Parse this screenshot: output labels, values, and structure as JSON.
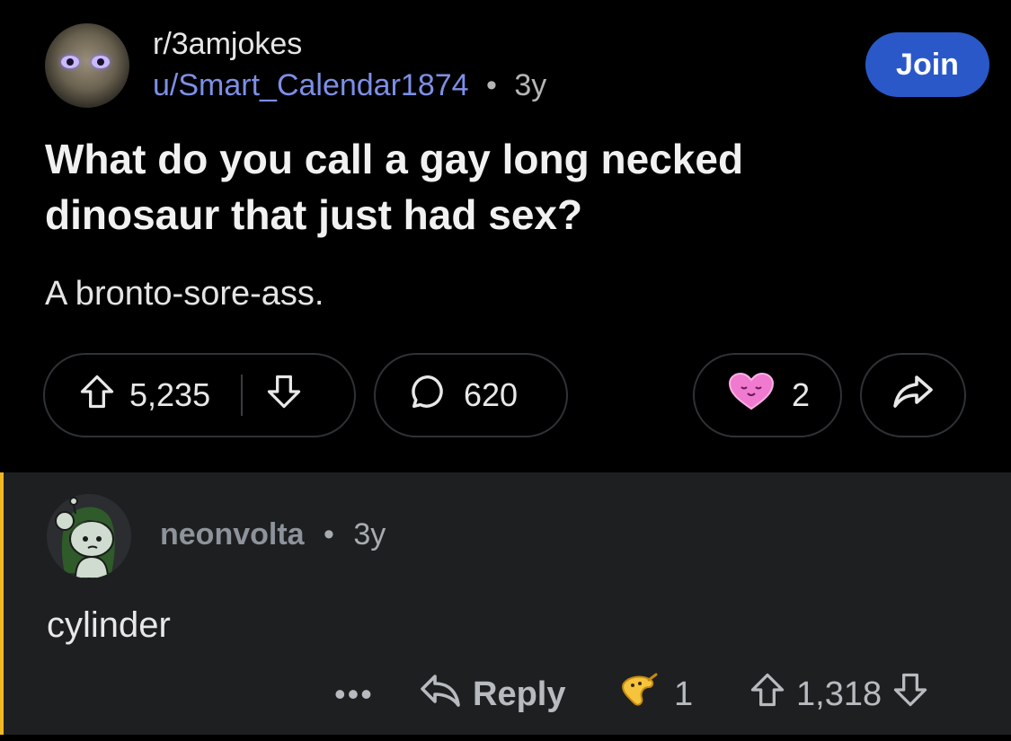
{
  "post": {
    "subreddit": "r/3amjokes",
    "author": "u/Smart_Calendar1874",
    "separator": "•",
    "age": "3y",
    "join_label": "Join",
    "title": "What do you call a gay long necked dinosaur that just had sex?",
    "body": "A bronto-sore-ass.",
    "upvotes": "5,235",
    "comments": "620",
    "awards": "2",
    "icons": [
      "upvote-icon",
      "downvote-icon",
      "comment-icon",
      "heart-award-icon",
      "share-icon"
    ]
  },
  "comment": {
    "author": "neonvolta",
    "separator": "•",
    "age": "3y",
    "text": "cylinder",
    "more_label": "•••",
    "reply_label": "Reply",
    "awards": "1",
    "score": "1,318",
    "icons": [
      "reply-icon",
      "banana-award-icon",
      "upvote-icon",
      "downvote-icon"
    ]
  },
  "colors": {
    "background": "#000000",
    "join_button": "#2a58c9",
    "username_link": "#7d8fe6",
    "comment_background": "#1e1f21",
    "thread_line": "#f2b824"
  }
}
